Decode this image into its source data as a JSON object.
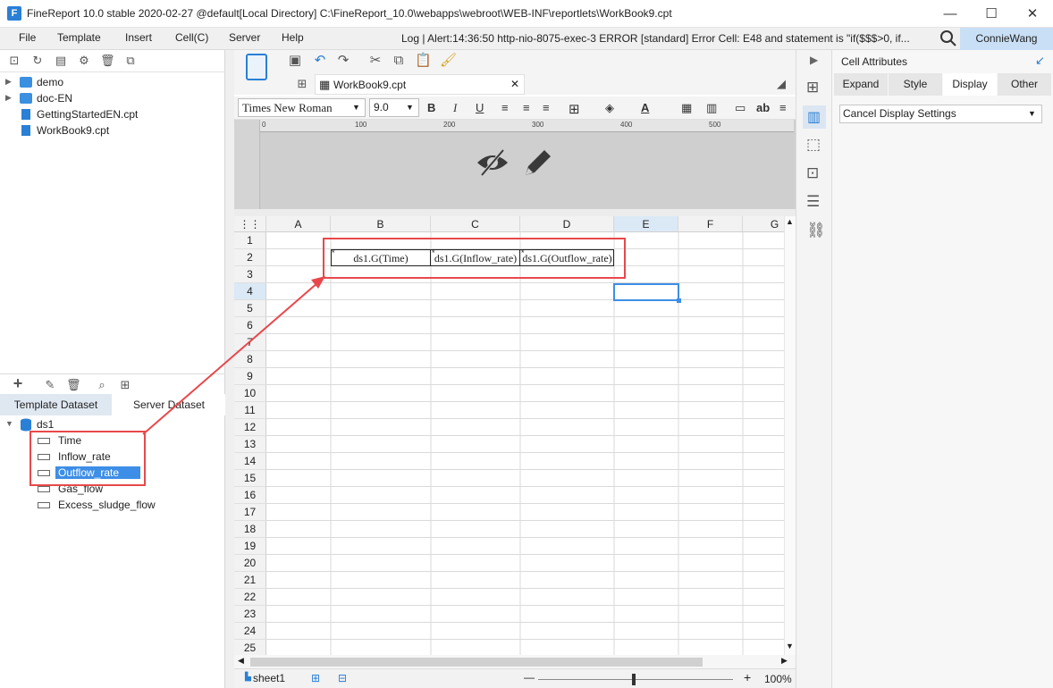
{
  "window": {
    "title": "FineReport 10.0 stable 2020-02-27 @default[Local Directory]     C:\\FineReport_10.0\\webapps\\webroot\\WEB-INF\\reportlets\\WorkBook9.cpt",
    "minimize": "—",
    "maximize": "☐",
    "close": "✕"
  },
  "menu": {
    "items": [
      "File",
      "Template",
      "Insert",
      "Cell(C)",
      "Server",
      "Help"
    ],
    "log": "Log | Alert:14:36:50 http-nio-8075-exec-3 ERROR [standard] Error Cell: E48 and statement is \"if($$$>0, if...",
    "user": "ConnieWang"
  },
  "file_tree": [
    {
      "type": "folder",
      "label": "demo"
    },
    {
      "type": "folder",
      "label": "doc-EN"
    },
    {
      "type": "cpt",
      "label": "GettingStartedEN.cpt"
    },
    {
      "type": "cpt",
      "label": "WorkBook9.cpt"
    }
  ],
  "dataset_tabs": {
    "template": "Template Dataset",
    "server": "Server Dataset"
  },
  "dataset": {
    "name": "ds1",
    "fields": [
      "Time",
      "Inflow_rate",
      "Outflow_rate",
      "Gas_flow",
      "Excess_sludge_flow"
    ],
    "selected": "Outflow_rate"
  },
  "editor": {
    "tab": "WorkBook9.cpt",
    "font": "Times New Roman",
    "size": "9.0",
    "bold": "B",
    "italic": "I",
    "underline": "U",
    "text_color": "A",
    "ab_label": "ab"
  },
  "ruler": {
    "labels": [
      "0",
      "100",
      "200",
      "300",
      "400",
      "500"
    ]
  },
  "grid": {
    "columns": [
      "A",
      "B",
      "C",
      "D",
      "E",
      "F",
      "G"
    ],
    "active_column": "E",
    "active_row": "4",
    "rows": [
      "1",
      "2",
      "3",
      "4",
      "5",
      "6",
      "7",
      "8",
      "9",
      "10",
      "11",
      "12",
      "13",
      "14",
      "15",
      "16",
      "17",
      "18",
      "19",
      "20",
      "21",
      "22",
      "23",
      "24",
      "25"
    ],
    "cells": {
      "B2": "ds1.G(Time)",
      "C2": "ds1.G(Inflow_rate)",
      "D2": "ds1.G(Outflow_rate)"
    }
  },
  "status": {
    "sheet": "sheet1",
    "zoom": "100%",
    "minus": "—",
    "plus": "+"
  },
  "right_panel": {
    "title": "Cell Attributes",
    "tabs": [
      "Expand",
      "Style",
      "Display",
      "Other"
    ],
    "active_tab": "Display",
    "select_value": "Cancel Display Settings"
  },
  "colors": {
    "accent": "#2a7fd6",
    "annotation": "#e8484b",
    "selection": "#3d8ee6"
  }
}
